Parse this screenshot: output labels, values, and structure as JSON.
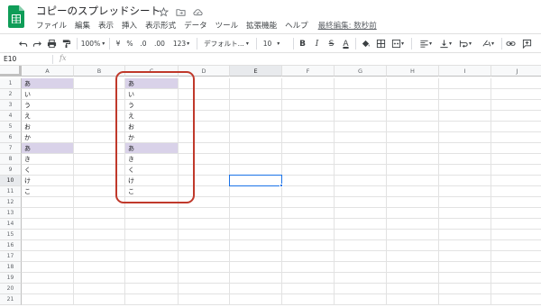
{
  "app": {
    "title": "コピーのスプレッドシート",
    "brand_color": "#0f9d58"
  },
  "menu": [
    "ファイル",
    "編集",
    "表示",
    "挿入",
    "表示形式",
    "データ",
    "ツール",
    "拡張機能",
    "ヘルプ"
  ],
  "last_edit": "最終編集: 数秒前",
  "toolbar": {
    "zoom": "100%",
    "currency": "¥",
    "percent": "%",
    "dec_decrease": ".0",
    "dec_increase": ".00",
    "more_formats": "123",
    "font": "デフォルト...",
    "font_size": "10",
    "bold": "B",
    "italic": "I",
    "strike": "S",
    "text_color": "A"
  },
  "formula_bar": {
    "cell_ref": "E10",
    "fx": "fx",
    "value": ""
  },
  "columns": [
    "A",
    "B",
    "C",
    "D",
    "E",
    "F",
    "G",
    "H",
    "I",
    "J"
  ],
  "rows": [
    "1",
    "2",
    "3",
    "4",
    "5",
    "6",
    "7",
    "8",
    "9",
    "10",
    "11",
    "12",
    "13",
    "14",
    "15",
    "16",
    "17",
    "18",
    "19",
    "20",
    "21"
  ],
  "column_a": [
    "あ",
    "い",
    "う",
    "え",
    "お",
    "か",
    "あ",
    "き",
    "く",
    "け",
    "こ"
  ],
  "column_c": [
    "あ",
    "い",
    "う",
    "え",
    "お",
    "か",
    "あ",
    "き",
    "く",
    "け",
    "こ"
  ],
  "highlight_color": "#d9d2e9",
  "highlighted_rows": [
    1,
    7
  ],
  "active_cell": "E10",
  "annotation_color": "#c0392b"
}
